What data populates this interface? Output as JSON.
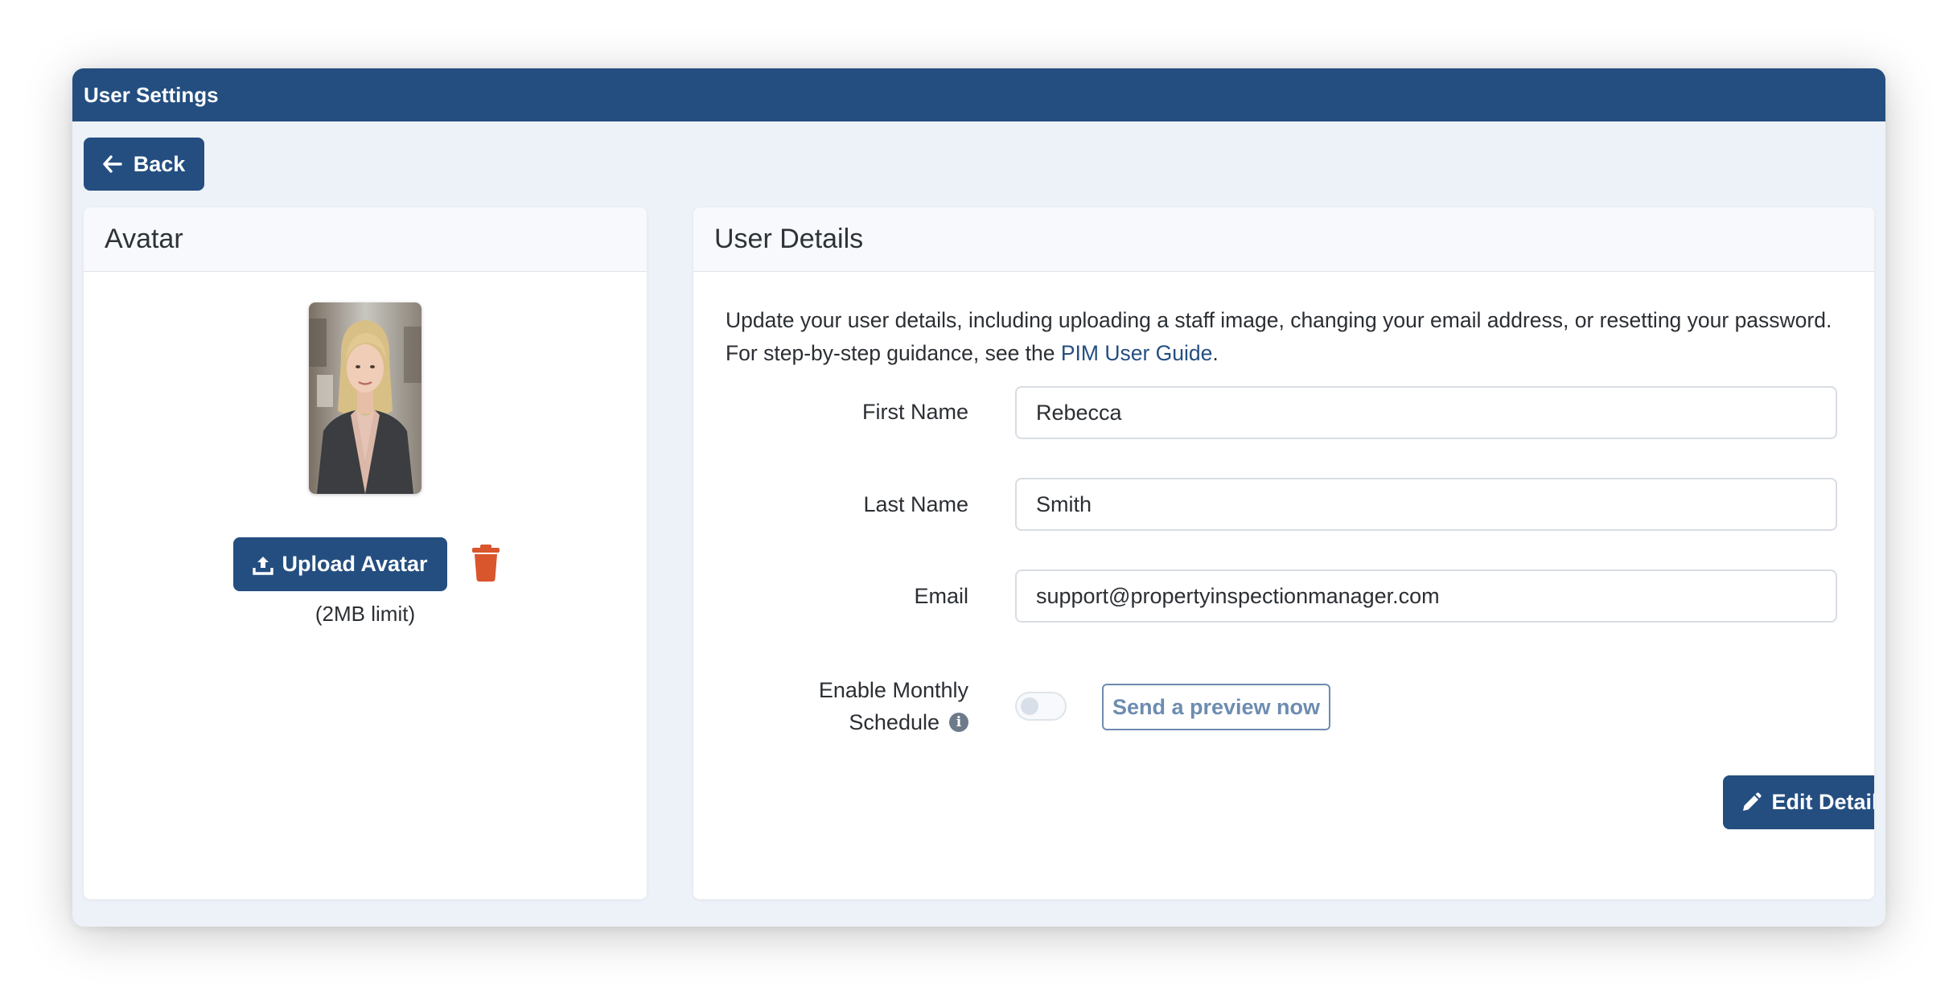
{
  "window": {
    "title": "User Settings"
  },
  "toolbar": {
    "back_label": "Back"
  },
  "avatar_card": {
    "title": "Avatar",
    "upload_label": "Upload Avatar",
    "limit_text": "(2MB limit)"
  },
  "details_card": {
    "title": "User Details",
    "intro_text": "Update your user details, including uploading a staff image, changing your email address, or resetting your password. For step-by-step guidance, see the ",
    "guide_link": "PIM User Guide",
    "intro_end": ".",
    "first_name": {
      "label": "First Name",
      "value": "Rebecca"
    },
    "last_name": {
      "label": "Last Name",
      "value": "Smith"
    },
    "email": {
      "label": "Email",
      "value": "support@propertyinspectionmanager.com"
    },
    "schedule": {
      "label_line1": "Enable Monthly",
      "label_line2": "Schedule",
      "enabled": false
    },
    "preview_label": "Send a preview now",
    "edit_label": "Edit Details"
  },
  "colors": {
    "primary": "#244e80",
    "danger": "#d9552c",
    "outline": "#6d8cb0",
    "background": "#edf1f8"
  },
  "icons": {
    "back": "arrow-left-icon",
    "upload": "upload-icon",
    "delete": "trash-icon",
    "info": "info-icon",
    "edit": "pencil-icon"
  }
}
